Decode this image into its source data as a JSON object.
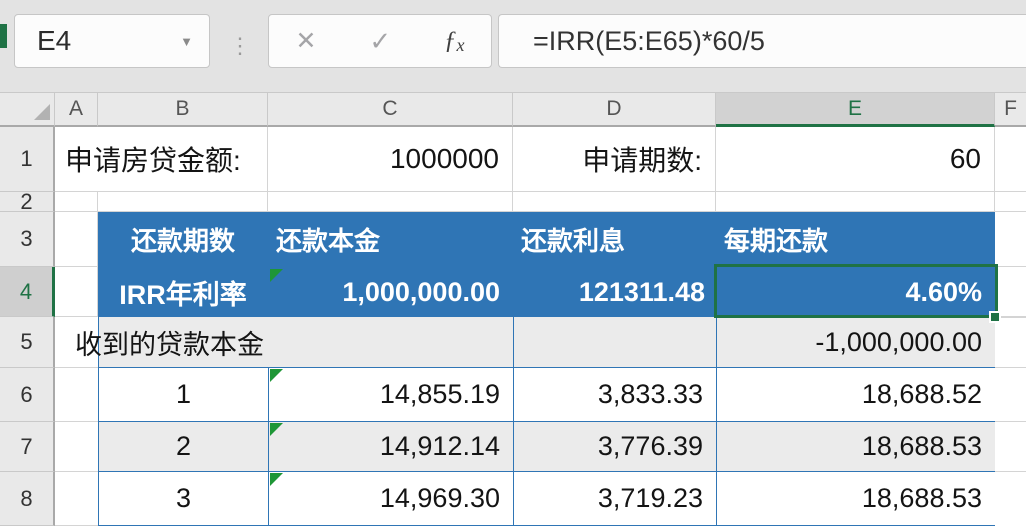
{
  "colors": {
    "table_blue": "#2f75b5",
    "selection_green": "#1f7245",
    "error_triangle_green": "#1e9636",
    "band_gray": "#ebebeb",
    "toolbar_gray": "#e3e3e3"
  },
  "formula_bar": {
    "name_box_value": "E4",
    "formula": "=IRR(E5:E65)*60/5",
    "icons": {
      "name_box_dropdown": "▼",
      "separator_dots": "⋮",
      "cancel": "✕",
      "enter": "✓",
      "insert_function_f": "ƒ",
      "insert_function_x": "x"
    }
  },
  "grid": {
    "columns": [
      "A",
      "B",
      "C",
      "D",
      "E",
      "F"
    ],
    "rows": [
      "1",
      "2",
      "3",
      "4",
      "5",
      "6",
      "7",
      "8"
    ],
    "selected_cell": "E4",
    "selected_column": "E",
    "selected_row": "4"
  },
  "sheet": {
    "row1": {
      "loan_label": "申请房贷金额:",
      "loan_amount": "1000000",
      "periods_label": "申请期数:",
      "periods_value": "60"
    },
    "table": {
      "headers": [
        "还款期数",
        "还款本金",
        "还款利息",
        "每期还款"
      ],
      "irr_row": {
        "label": "IRR年利率",
        "principal": "1,000,000.00",
        "interest": "121311.48",
        "rate": "4.60%"
      },
      "loan_row": {
        "label": "收到的贷款本金",
        "payment": "-1,000,000.00"
      },
      "rows": [
        {
          "period": "1",
          "principal": "14,855.19",
          "interest": "3,833.33",
          "payment": "18,688.52"
        },
        {
          "period": "2",
          "principal": "14,912.14",
          "interest": "3,776.39",
          "payment": "18,688.53"
        },
        {
          "period": "3",
          "principal": "14,969.30",
          "interest": "3,719.23",
          "payment": "18,688.53"
        }
      ]
    }
  }
}
